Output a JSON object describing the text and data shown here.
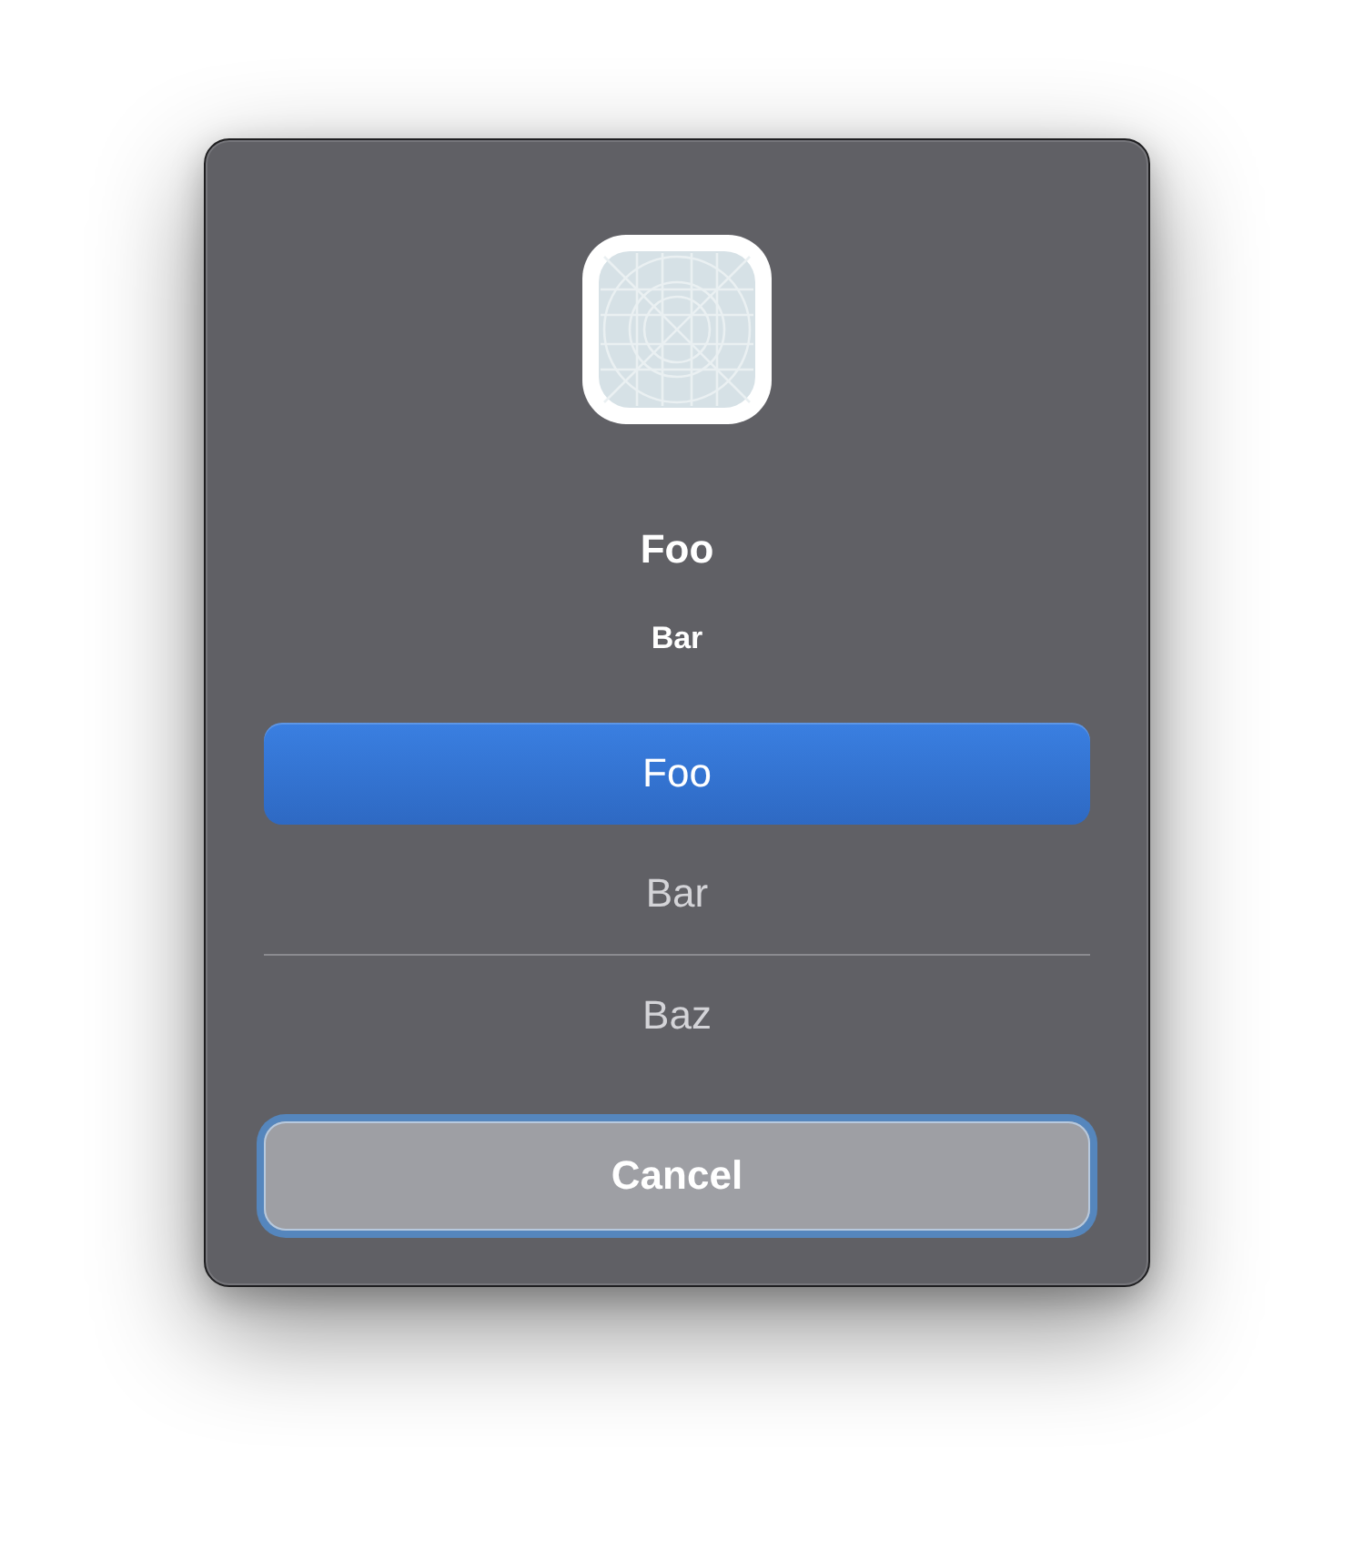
{
  "dialog": {
    "title": "Foo",
    "message": "Bar"
  },
  "options": [
    {
      "label": "Foo",
      "selected": true
    },
    {
      "label": "Bar",
      "selected": false
    },
    {
      "label": "Baz",
      "selected": false
    }
  ],
  "cancel_button": {
    "label": "Cancel",
    "focused": true
  }
}
